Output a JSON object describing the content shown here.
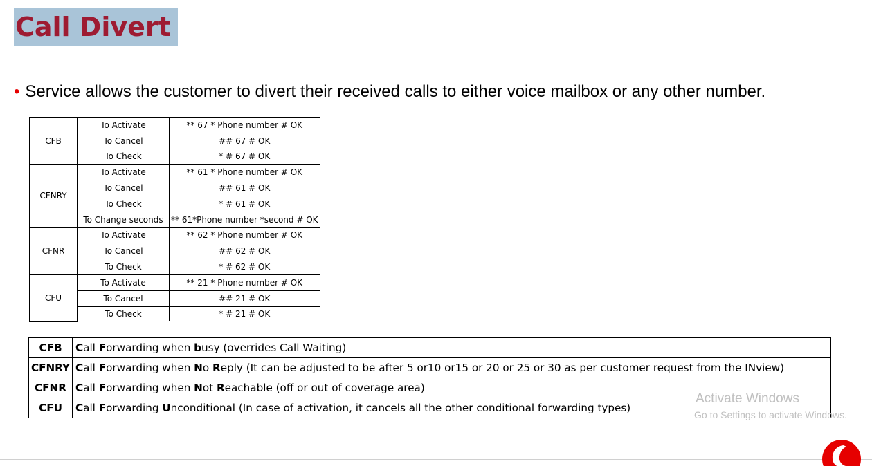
{
  "title": "Call Divert",
  "bullet": "Service allows the customer to divert their received calls to either voice mailbox or any other number.",
  "codes_table": [
    {
      "service": "CFB",
      "rows": [
        {
          "action": "To Activate",
          "code": "** 67 * Phone number # OK"
        },
        {
          "action": "To Cancel",
          "code": "## 67 # OK"
        },
        {
          "action": "To Check",
          "code": "* # 67 # OK"
        }
      ]
    },
    {
      "service": "CFNRY",
      "rows": [
        {
          "action": "To Activate",
          "code": "** 61 * Phone number # OK"
        },
        {
          "action": "To Cancel",
          "code": "## 61 # OK"
        },
        {
          "action": "To Check",
          "code": "* # 61 # OK"
        },
        {
          "action": "To Change seconds",
          "code": "** 61*Phone number *second # OK"
        }
      ]
    },
    {
      "service": "CFNR",
      "rows": [
        {
          "action": "To Activate",
          "code": "** 62 * Phone number # OK"
        },
        {
          "action": "To Cancel",
          "code": "## 62 # OK"
        },
        {
          "action": "To Check",
          "code": "* # 62 # OK"
        }
      ]
    },
    {
      "service": "CFU",
      "rows": [
        {
          "action": "To Activate",
          "code": "** 21 * Phone number # OK"
        },
        {
          "action": "To Cancel",
          "code": "## 21 # OK"
        },
        {
          "action": "To Check",
          "code": "* # 21 # OK"
        }
      ]
    }
  ],
  "legend": [
    {
      "abbr": "CFB",
      "parts": [
        [
          "b",
          "C"
        ],
        [
          "t",
          "all "
        ],
        [
          "b",
          "F"
        ],
        [
          "t",
          "orwarding when "
        ],
        [
          "b",
          "b"
        ],
        [
          "t",
          "usy (overrides Call Waiting)"
        ]
      ]
    },
    {
      "abbr": "CFNRY",
      "parts": [
        [
          "b",
          "C"
        ],
        [
          "t",
          "all "
        ],
        [
          "b",
          "F"
        ],
        [
          "t",
          "orwarding when "
        ],
        [
          "b",
          "N"
        ],
        [
          "t",
          "o "
        ],
        [
          "b",
          "R"
        ],
        [
          "t",
          "eply (It can be adjusted to be after 5 or10 or15 or 20 or 25 or 30 as per customer request from the INview)"
        ]
      ]
    },
    {
      "abbr": "CFNR",
      "parts": [
        [
          "b",
          "C"
        ],
        [
          "t",
          "all "
        ],
        [
          "b",
          "F"
        ],
        [
          "t",
          "orwarding when "
        ],
        [
          "b",
          "N"
        ],
        [
          "t",
          "ot "
        ],
        [
          "b",
          "R"
        ],
        [
          "t",
          "eachable (off or out of coverage area)"
        ]
      ]
    },
    {
      "abbr": "CFU",
      "parts": [
        [
          "b",
          "C"
        ],
        [
          "t",
          "all "
        ],
        [
          "b",
          "F"
        ],
        [
          "t",
          "orwarding "
        ],
        [
          "b",
          "U"
        ],
        [
          "t",
          "nconditional (In case of activation, it cancels all the other conditional forwarding types)"
        ]
      ]
    }
  ],
  "watermark": {
    "line1": "Activate Windows",
    "line2": "Go to Settings to activate Windows."
  },
  "colors": {
    "title_text": "#9e1b32",
    "title_bg": "#a9c4d8",
    "bullet": "#e60000",
    "logo": "#e60000"
  },
  "logo_icon": "vodafone-logo-icon"
}
